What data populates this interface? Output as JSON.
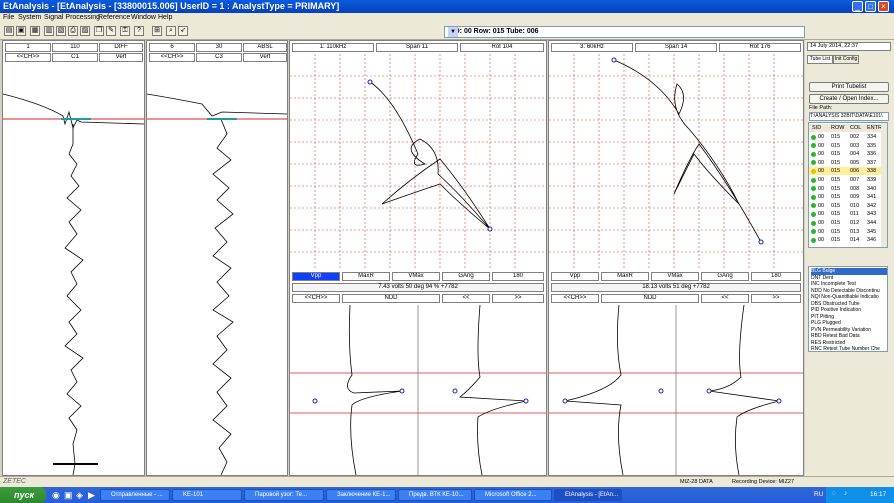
{
  "window": {
    "title": "EtAnalysis - [EtAnalysis - [33800015.006]          UserID = 1 : AnalystType = PRIMARY]"
  },
  "menu": [
    "File",
    "System",
    "Signal Processing",
    "Reference",
    "Window",
    "Help"
  ],
  "sid_box": "SID: 00   Row: 015   Tube: 006",
  "strip1": {
    "h1": [
      "1",
      "110",
      "DIFF"
    ],
    "h2": [
      "<<CH>>",
      "C1",
      "Vert"
    ]
  },
  "strip2": {
    "h1": [
      "6",
      "30",
      "ABSL"
    ],
    "h2": [
      "<<CH>>",
      "C3",
      "Vert"
    ]
  },
  "lis1": {
    "header": [
      "1: 110kHz",
      "Span 11",
      "Rot 104"
    ],
    "meas": [
      "Vpp",
      "MaxR",
      "VMax",
      "GAng",
      "180"
    ],
    "reading": "7.43 volts  50 deg  94 % +7782",
    "nav": [
      "<<CH>>",
      "NDD",
      "<<",
      ">>"
    ]
  },
  "lis2": {
    "header": [
      "3: 60kHz",
      "Span 14",
      "Rot 176"
    ],
    "meas": [
      "Vpp",
      "MaxR",
      "VMax",
      "GAng",
      "180"
    ],
    "reading": "18.13 volts  51 deg  +7782",
    "nav": [
      "<<CH>>",
      "NDD",
      "<<",
      ">>"
    ]
  },
  "right": {
    "date": "14 July 2014, 22:37",
    "tabs": [
      "Tube List",
      "Init Config"
    ],
    "print_btn": "Print Tubelist",
    "create_btn": "Create / Open Index...",
    "file_path_label": "File Path:",
    "file_path": "T:\\ANALYSIS 32BIT\\DATA\\E101\\",
    "columns": [
      "SID",
      "ROW",
      "COL",
      "ENTR"
    ],
    "rows": [
      {
        "sid": "00",
        "row": "015",
        "col": "002",
        "entry": "334"
      },
      {
        "sid": "00",
        "row": "015",
        "col": "003",
        "entry": "335"
      },
      {
        "sid": "00",
        "row": "015",
        "col": "004",
        "entry": "336"
      },
      {
        "sid": "00",
        "row": "015",
        "col": "005",
        "entry": "337"
      },
      {
        "sid": "00",
        "row": "015",
        "col": "006",
        "entry": "338"
      },
      {
        "sid": "00",
        "row": "015",
        "col": "007",
        "entry": "339"
      },
      {
        "sid": "00",
        "row": "015",
        "col": "008",
        "entry": "340"
      },
      {
        "sid": "00",
        "row": "015",
        "col": "009",
        "entry": "341"
      },
      {
        "sid": "00",
        "row": "015",
        "col": "010",
        "entry": "342"
      },
      {
        "sid": "00",
        "row": "015",
        "col": "011",
        "entry": "343"
      },
      {
        "sid": "00",
        "row": "015",
        "col": "012",
        "entry": "344"
      },
      {
        "sid": "00",
        "row": "015",
        "col": "013",
        "entry": "345"
      },
      {
        "sid": "00",
        "row": "015",
        "col": "014",
        "entry": "346"
      }
    ],
    "codes": [
      "BLG  Bulge",
      "DNT  Dent",
      "INC  Incomplete Test",
      "NDD  No Detectable Discontinu",
      "NQI  Non-Quantifiable Indicatio",
      "DBS  Obstructed Tube",
      "PID  Positive Indication",
      "PIT  Pitting",
      "PLG  Plugged",
      "PVN  Permeability Variation",
      "RBD  Retest Bad Data",
      "RES  Restricted",
      "RNC  Retest Tube Number Che"
    ]
  },
  "status": {
    "left": "ZETEC",
    "mid1": "MIZ-28 DATA",
    "mid2": "Recording Device: MIZ27"
  },
  "taskbar": {
    "start": "пуск",
    "items": [
      "Отправленные - ...",
      "KE-101",
      "Паровой узог: Те...",
      "Заключение КЕ-1...",
      "Предв. ВТК КЕ-10...",
      "Microsoft Office 2...",
      "EtAnalysis - [EtAn..."
    ],
    "lang": "RU",
    "clock": "16:17"
  }
}
